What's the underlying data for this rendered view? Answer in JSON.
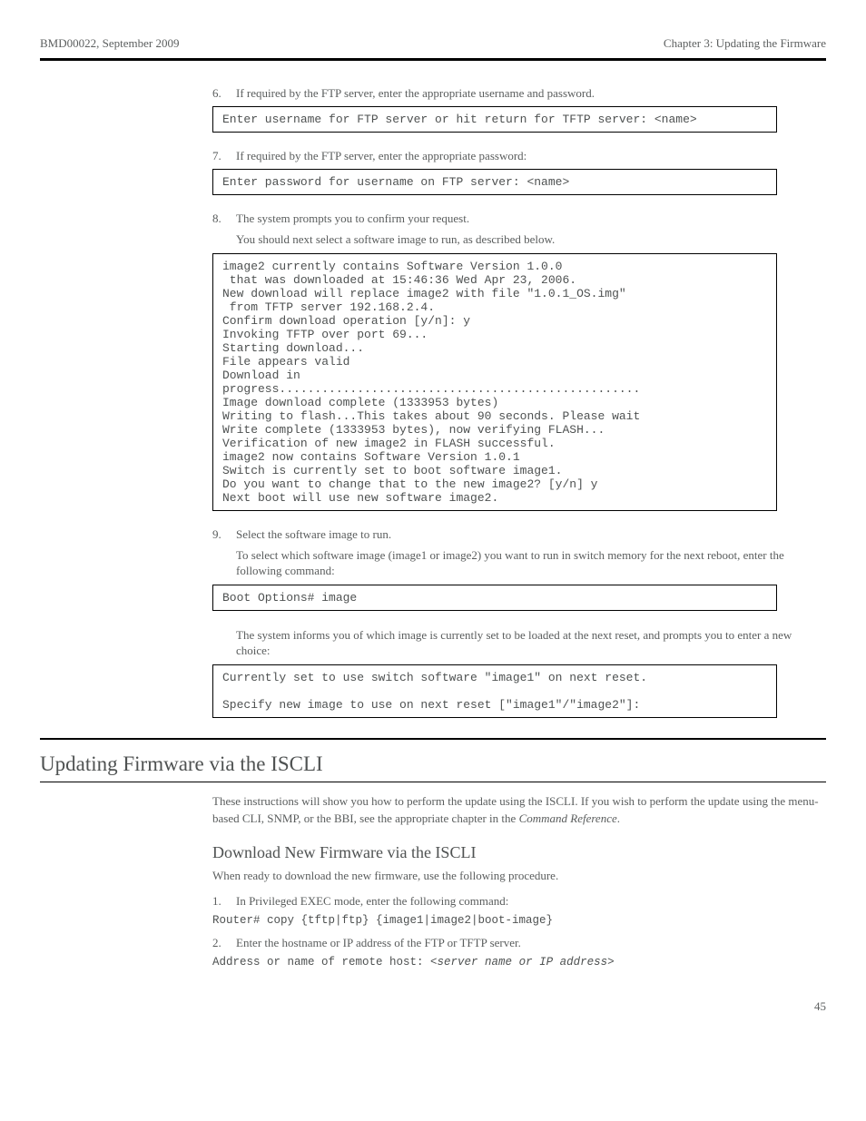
{
  "header": {
    "doc_id": "BMD00022",
    "date": "September 2009",
    "chapter": "Chapter 3: Updating the Firmware",
    "page": "45"
  },
  "steps": {
    "s6": {
      "num": "6.",
      "text": "If required by the FTP server, enter the appropriate username and password.",
      "code": "Enter username for FTP server or hit return for TFTP server: <name>"
    },
    "s7": {
      "num": "7.",
      "text": "If required by the FTP server, enter the appropriate password:",
      "code": "Enter password for username on FTP server: <name>"
    },
    "s8": {
      "num": "8.",
      "text_a": "The system prompts you to confirm your request.",
      "text_b": "You should next select a software image to run, as described below.",
      "code": "image2 currently contains Software Version 1.0.0\n that was downloaded at 15:46:36 Wed Apr 23, 2006.\nNew download will replace image2 with file \"1.0.1_OS.img\"\n from TFTP server 192.168.2.4.\nConfirm download operation [y/n]: y\nInvoking TFTP over port 69...\nStarting download...\nFile appears valid\nDownload in\nprogress...................................................\nImage download complete (1333953 bytes)\nWriting to flash...This takes about 90 seconds. Please wait\nWrite complete (1333953 bytes), now verifying FLASH...\nVerification of new image2 in FLASH successful.\nimage2 now contains Software Version 1.0.1\nSwitch is currently set to boot software image1.\nDo you want to change that to the new image2? [y/n] y\nNext boot will use new software image2."
    },
    "s9": {
      "num": "9.",
      "text_a": "Select the software image to run.",
      "text_b": "To select which software image (image1 or image2) you want to run in switch memory for the next reboot, enter the following command:",
      "code1": "Boot Options# image",
      "text_c": "The system informs you of which image is currently set to be loaded at the next reset, and prompts you to enter a new choice:",
      "code2": "Currently set to use switch software \"image1\" on next reset.\n\nSpecify new image to use on next reset [\"image1\"/\"image2\"]:"
    }
  },
  "section": {
    "title": "Updating Firmware via the ISCLI",
    "intro": "These instructions will show you how to perform the update using the ISCLI. If you wish to perform the update using the menu-based CLI, SNMP, or the BBI, see the appropriate chapter in the ",
    "intro_i": "Command Reference",
    "intro_end": "."
  },
  "download": {
    "title": "Download New Firmware via the ISCLI",
    "para_a": "When ready to download the new firmware, use the following procedure.",
    "step1_num": "1.",
    "step1_a": "In Privileged EXEC mode, enter the following command:",
    "cmd1": "Router# copy {tftp|ftp} {image1|image2|boot-image}",
    "step2_num": "2.",
    "step2_a": "Enter the hostname or IP address of the FTP or TFTP server.",
    "cmd2": "Address or name of remote host: <server name or IP address>"
  }
}
